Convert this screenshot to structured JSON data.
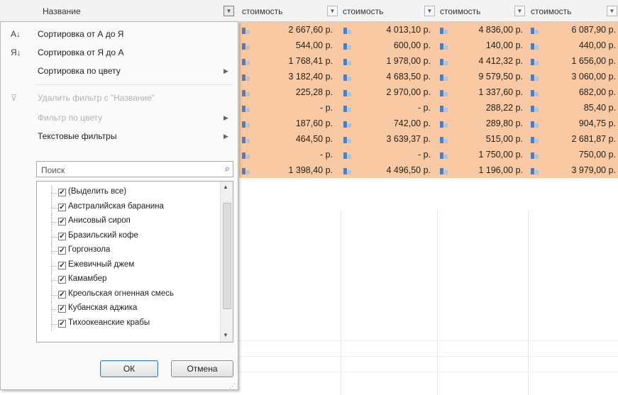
{
  "columns": {
    "name": "Название",
    "cost": [
      "стоимость",
      "стоимость",
      "стоимость",
      "стоимость"
    ]
  },
  "menu": {
    "sort_az": "Сортировка от А до Я",
    "sort_za": "Сортировка от Я до А",
    "sort_color": "Сортировка по цвету",
    "clear_filter": "Удалить фильтр с \"Название\"",
    "filter_color": "Фильтр по цвету",
    "text_filters": "Текстовые фильтры"
  },
  "search": {
    "placeholder": "Поиск"
  },
  "list": [
    "(Выделить все)",
    "Австралийская баранина",
    "Анисовый сироп",
    "Бразильский кофе",
    "Горгонзола",
    "Ежевичный джем",
    "Камамбер",
    "Креольская огненная смесь",
    "Кубанская аджика",
    "Тихоокеанские крабы"
  ],
  "buttons": {
    "ok": "ОК",
    "cancel": "Отмена"
  },
  "rows": [
    [
      "2 667,60 р.",
      "4 013,10 р.",
      "4 836,00 р.",
      "6 087,90 р."
    ],
    [
      "544,00 р.",
      "600,00 р.",
      "140,00 р.",
      "440,00 р."
    ],
    [
      "1 768,41 р.",
      "1 978,00 р.",
      "4 412,32 р.",
      "1 656,00 р."
    ],
    [
      "3 182,40 р.",
      "4 683,50 р.",
      "9 579,50 р.",
      "3 060,00 р."
    ],
    [
      "225,28 р.",
      "2 970,00 р.",
      "1 337,60 р.",
      "682,00 р."
    ],
    [
      "-    р.",
      "-    р.",
      "288,22 р.",
      "85,40 р."
    ],
    [
      "187,60 р.",
      "742,00 р.",
      "289,80 р.",
      "904,75 р."
    ],
    [
      "464,50 р.",
      "3 639,37 р.",
      "515,00 р.",
      "2 681,87 р."
    ],
    [
      "-    р.",
      "-    р.",
      "1 750,00 р.",
      "750,00 р."
    ],
    [
      "1 398,40 р.",
      "4 496,50 р.",
      "1 196,00 р.",
      "3 979,00 р."
    ]
  ],
  "colors": {
    "row_fill": "#f8c9a2",
    "icon_bar": "#4d7fbf"
  }
}
